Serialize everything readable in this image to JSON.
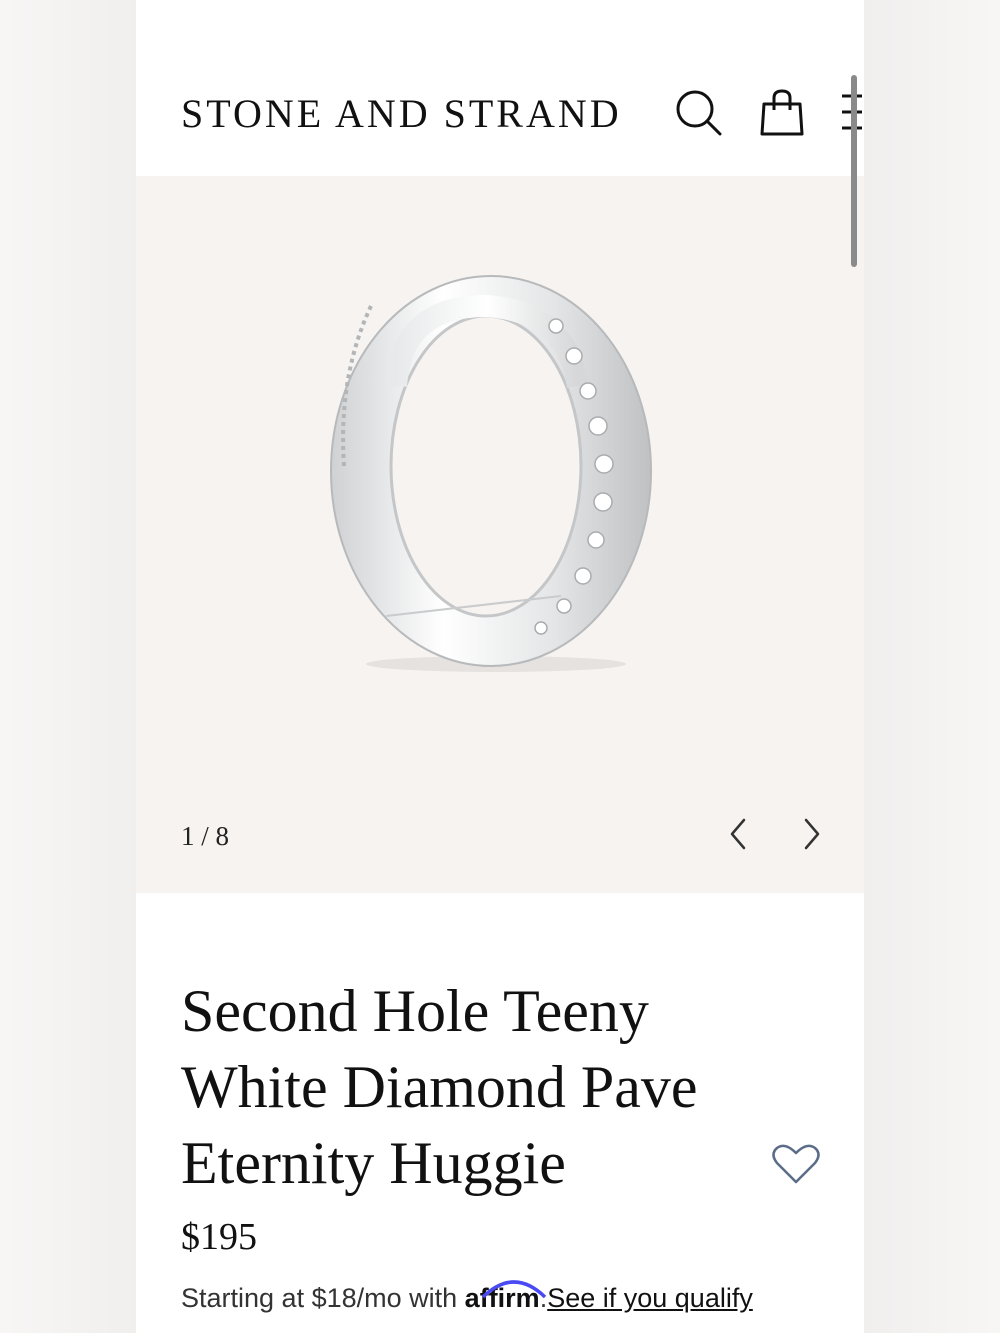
{
  "header": {
    "logo": "STONE AND STRAND",
    "icons": [
      "search-icon",
      "bag-icon",
      "menu-icon"
    ]
  },
  "gallery": {
    "counter": "1 / 8",
    "image_alt": "Second Hole Teeny White Diamond Pave Eternity Huggie"
  },
  "product": {
    "title_lines": [
      "Second Hole Teeny",
      "White Diamond Pave",
      "Eternity Huggie"
    ],
    "price": "$195",
    "finance_prefix": "Starting at $18/mo with",
    "finance_brand": "affirm",
    "finance_dot": ".",
    "finance_link": "See if you qualify"
  },
  "colors": {
    "background": "#ffffff",
    "gallery_bg": "#f6f3f1",
    "affirm_accent": "#4a4af4"
  }
}
